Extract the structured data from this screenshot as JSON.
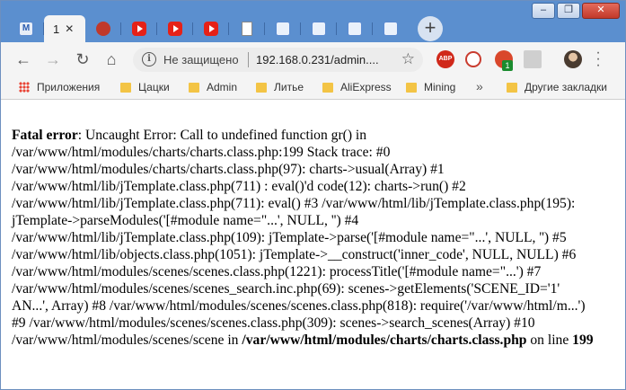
{
  "browser": {
    "tabs": [
      {
        "icon": "m-icon"
      },
      {
        "number": "1",
        "close": "✕",
        "active": true
      },
      {
        "icon": "gear-red-icon"
      },
      {
        "icon": "youtube-icon"
      },
      {
        "icon": "youtube-icon"
      },
      {
        "icon": "youtube-icon"
      },
      {
        "icon": "document-icon"
      },
      {
        "icon": "pr-icon"
      },
      {
        "icon": "pr-icon"
      },
      {
        "icon": "pr-icon"
      },
      {
        "icon": "pr-icon"
      }
    ],
    "new_tab": "+",
    "window_controls": {
      "minimize": "–",
      "maximize": "❐",
      "close": "✕"
    }
  },
  "toolbar": {
    "back": "←",
    "forward": "→",
    "reload": "↻",
    "home": "⌂",
    "security_status": "Не защищено",
    "url": "192.168.0.231/admin....",
    "star": "☆",
    "ext_abp": "ABP",
    "ext_badge": "1"
  },
  "bookmarks": {
    "apps_label": "Приложения",
    "items": [
      "Цацки",
      "Admin",
      "Литье",
      "AliExpress",
      "Mining"
    ],
    "more": "»",
    "other": "Другие закладки"
  },
  "error": {
    "label": "Fatal error",
    "lines": [
      ": Uncaught Error: Call to undefined function gr() in",
      "/var/www/html/modules/charts/charts.class.php:199 Stack trace: #0",
      "/var/www/html/modules/charts/charts.class.php(97): charts->usual(Array) #1",
      "/var/www/html/lib/jTemplate.class.php(711) : eval()'d code(12): charts->run() #2",
      "/var/www/html/lib/jTemplate.class.php(711): eval() #3 /var/www/html/lib/jTemplate.class.php(195):",
      "jTemplate->parseModules('[#module name=\"...', NULL, '') #4",
      "/var/www/html/lib/jTemplate.class.php(109): jTemplate->parse('[#module name=\"...', NULL, '') #5",
      "/var/www/html/lib/objects.class.php(1051): jTemplate->__construct('inner_code', NULL, NULL) #6",
      "/var/www/html/modules/scenes/scenes.class.php(1221): processTitle('[#module name=\"...') #7",
      "/var/www/html/modules/scenes/scenes_search.inc.php(69): scenes->getElements('SCENE_ID='1'",
      "AN...', Array) #8 /var/www/html/modules/scenes/scenes.class.php(818): require('/var/www/html/m...')",
      "#9 /var/www/html/modules/scenes/scenes.class.php(309): scenes->search_scenes(Array) #10",
      "/var/www/html/modules/scenes/scene in "
    ],
    "file": "/var/www/html/modules/charts/charts.class.php",
    "on_line": " on line ",
    "line_number": "199"
  }
}
